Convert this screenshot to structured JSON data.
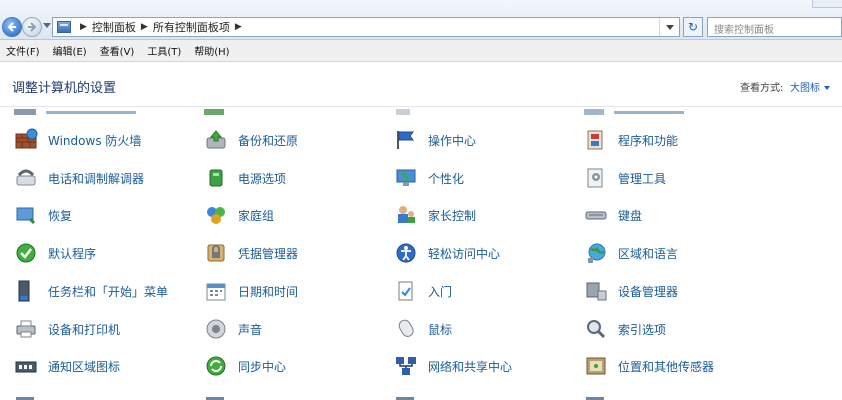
{
  "address": {
    "crumbs": [
      "控制面板",
      "所有控制面板项"
    ],
    "search_placeholder": "搜索控制面板"
  },
  "menu": [
    "文件(F)",
    "编辑(E)",
    "查看(V)",
    "工具(T)",
    "帮助(H)"
  ],
  "header": {
    "title": "调整计算机的设置",
    "view_label": "查看方式:",
    "view_value": "大图标"
  },
  "items": [
    [
      "Windows 防火墙",
      "备份和还原",
      "操作中心",
      "程序和功能"
    ],
    [
      "电话和调制解调器",
      "电源选项",
      "个性化",
      "管理工具"
    ],
    [
      "恢复",
      "家庭组",
      "家长控制",
      "键盘"
    ],
    [
      "默认程序",
      "凭据管理器",
      "轻松访问中心",
      "区域和语言"
    ],
    [
      "任务栏和「开始」菜单",
      "日期和时间",
      "入门",
      "设备管理器"
    ],
    [
      "设备和打印机",
      "声音",
      "鼠标",
      "索引选项"
    ],
    [
      "通知区域图标",
      "同步中心",
      "网络和共享中心",
      "位置和其他传感器"
    ]
  ],
  "icons": [
    [
      "firewall-icon",
      "backup-restore-icon",
      "action-center-icon",
      "programs-features-icon"
    ],
    [
      "phone-modem-icon",
      "power-options-icon",
      "personalization-icon",
      "admin-tools-icon"
    ],
    [
      "recovery-icon",
      "homegroup-icon",
      "parental-controls-icon",
      "keyboard-icon"
    ],
    [
      "default-programs-icon",
      "credential-manager-icon",
      "ease-of-access-icon",
      "region-language-icon"
    ],
    [
      "taskbar-start-menu-icon",
      "date-time-icon",
      "getting-started-icon",
      "device-manager-icon"
    ],
    [
      "devices-printers-icon",
      "sound-icon",
      "mouse-icon",
      "indexing-options-icon"
    ],
    [
      "notification-area-icon",
      "sync-center-icon",
      "network-sharing-icon",
      "location-sensors-icon"
    ]
  ],
  "colors": {
    "link": "#1a5c96",
    "title": "#1e3a6e",
    "accent": "#1e5fb0"
  }
}
